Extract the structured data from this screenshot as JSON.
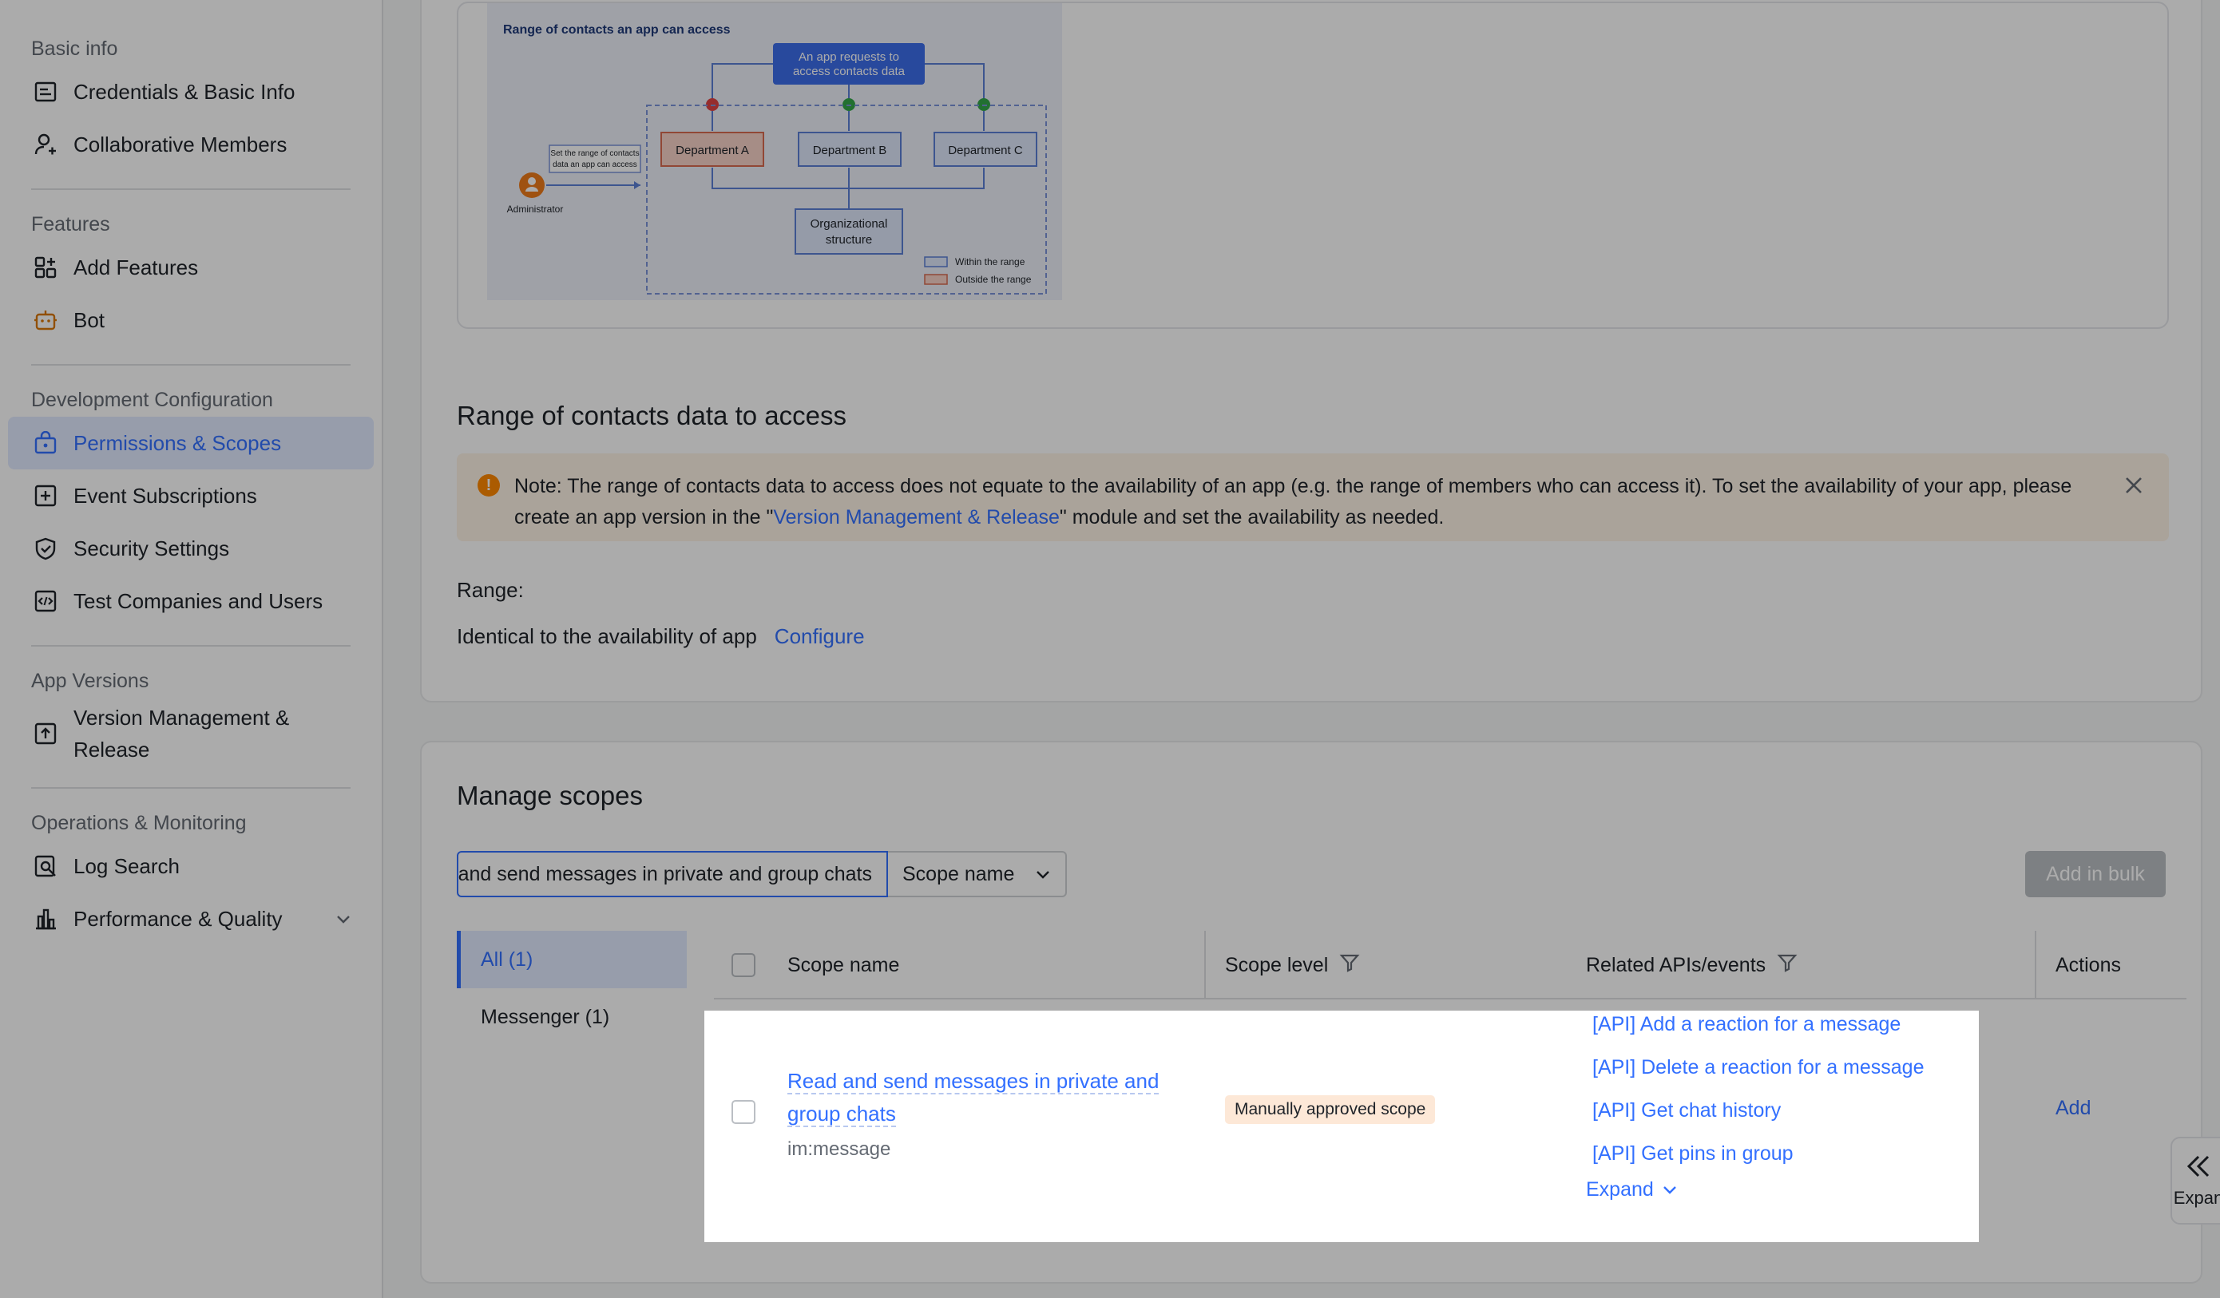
{
  "sidebar": {
    "sections": [
      {
        "title": "Basic info",
        "items": [
          {
            "label": "Credentials & Basic Info",
            "icon": "credentials-icon"
          },
          {
            "label": "Collaborative Members",
            "icon": "user-add-icon"
          }
        ]
      },
      {
        "title": "Features",
        "items": [
          {
            "label": "Add Features",
            "icon": "add-features-icon"
          },
          {
            "label": "Bot",
            "icon": "bot-icon"
          }
        ]
      },
      {
        "title": "Development Configuration",
        "items": [
          {
            "label": "Permissions & Scopes",
            "icon": "permissions-icon",
            "active": true
          },
          {
            "label": "Event Subscriptions",
            "icon": "event-icon"
          },
          {
            "label": "Security Settings",
            "icon": "shield-icon"
          },
          {
            "label": "Test Companies and Users",
            "icon": "code-icon"
          }
        ]
      },
      {
        "title": "App Versions",
        "items": [
          {
            "label": "Version Management & Release",
            "icon": "upload-icon"
          }
        ]
      },
      {
        "title": "Operations & Monitoring",
        "items": [
          {
            "label": "Log Search",
            "icon": "log-search-icon"
          },
          {
            "label": "Performance & Quality",
            "icon": "bar-chart-icon"
          }
        ]
      }
    ]
  },
  "diagram": {
    "title": "Range of contacts an app can access",
    "request": "An app requests to access contacts data",
    "dept_a": "Department A",
    "dept_b": "Department B",
    "dept_c": "Department C",
    "org": "Organizational structure",
    "set_range": "Set the range of contacts data an app can access",
    "admin": "Administrator",
    "legend_in": "Within the range",
    "legend_out": "Outside the range"
  },
  "contacts": {
    "title": "Range of contacts data to access",
    "notice_prefix": "Note: The range of contacts data to access does not equate to the availability of an app (e.g. the range of members who can access it). To set the availability of your app, please create an app version in the \"",
    "notice_link": "Version Management & Release",
    "notice_suffix": "\" module and set the availability as needed.",
    "range_label": "Range:",
    "range_value": "Identical to the availability of app",
    "configure": "Configure"
  },
  "scopes": {
    "title": "Manage scopes",
    "search_value": "Read and send messages in private and group chats",
    "filter_select": "Scope name",
    "bulk_button": "Add in bulk",
    "categories": [
      {
        "label": "All (1)",
        "active": true
      },
      {
        "label": "Messenger (1)"
      }
    ],
    "columns": {
      "scope_name": "Scope name",
      "scope_level": "Scope level",
      "related": "Related APIs/events",
      "actions": "Actions"
    },
    "rows": [
      {
        "name": "Read and send messages in private and group chats",
        "code": "im:message",
        "level": "Manually approved scope",
        "apis": [
          "[API] Add a reaction for a message",
          "[API] Delete a reaction for a message",
          "[API] Get chat history",
          "[API] Get pins in group"
        ],
        "expand": "Expand",
        "action": "Add"
      }
    ]
  },
  "fab": {
    "label": "Expan"
  }
}
